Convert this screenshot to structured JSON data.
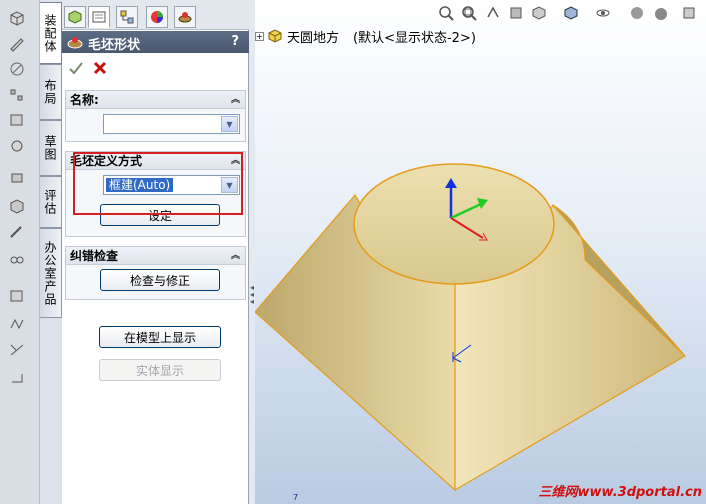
{
  "left_toolbar": {
    "icons": [
      "part-icon",
      "sketch-icon",
      "features-icon",
      "mate-icon",
      "component-icon",
      "assembly-icon",
      "explode-icon",
      "view-icon",
      "bom-icon",
      "measure-icon",
      "mirror-icon",
      "pattern-icon",
      "weld-icon",
      "drawing-icon",
      "dimension-icon"
    ]
  },
  "vertical_tabs": {
    "assembly": "装配体",
    "layout": "布局",
    "sketch": "草图",
    "evaluate": "评估",
    "office": "办公室产品"
  },
  "panel_tabs": [
    "feature-manager-tab",
    "property-manager-tab",
    "configuration-manager-tab",
    "appearance-tab",
    "display-manager-tab"
  ],
  "property_manager": {
    "title": "毛坯形状",
    "help": "?",
    "name_group": {
      "title": "名称:",
      "value": ""
    },
    "definition_group": {
      "title": "毛坯定义方式",
      "selected_option": "框建(Auto)",
      "set_button": "设定"
    },
    "correction_group": {
      "title": "纠错检查",
      "check_button": "检查与修正"
    },
    "show_on_model_button": "在模型上显示",
    "solid_display_button": "实体显示"
  },
  "viewport": {
    "tree_root_label": "天圆地方",
    "config_label": "(默认<显示状态-2>)",
    "axis_number": "7",
    "watermark": "三维网www.3dportal.cn"
  },
  "colors": {
    "highlight_box": "#d42020",
    "model_fill": "#e4d39a",
    "model_edge": "#e59c1c",
    "header_bg": "#4a5870",
    "selection_blue": "#316ac5"
  }
}
